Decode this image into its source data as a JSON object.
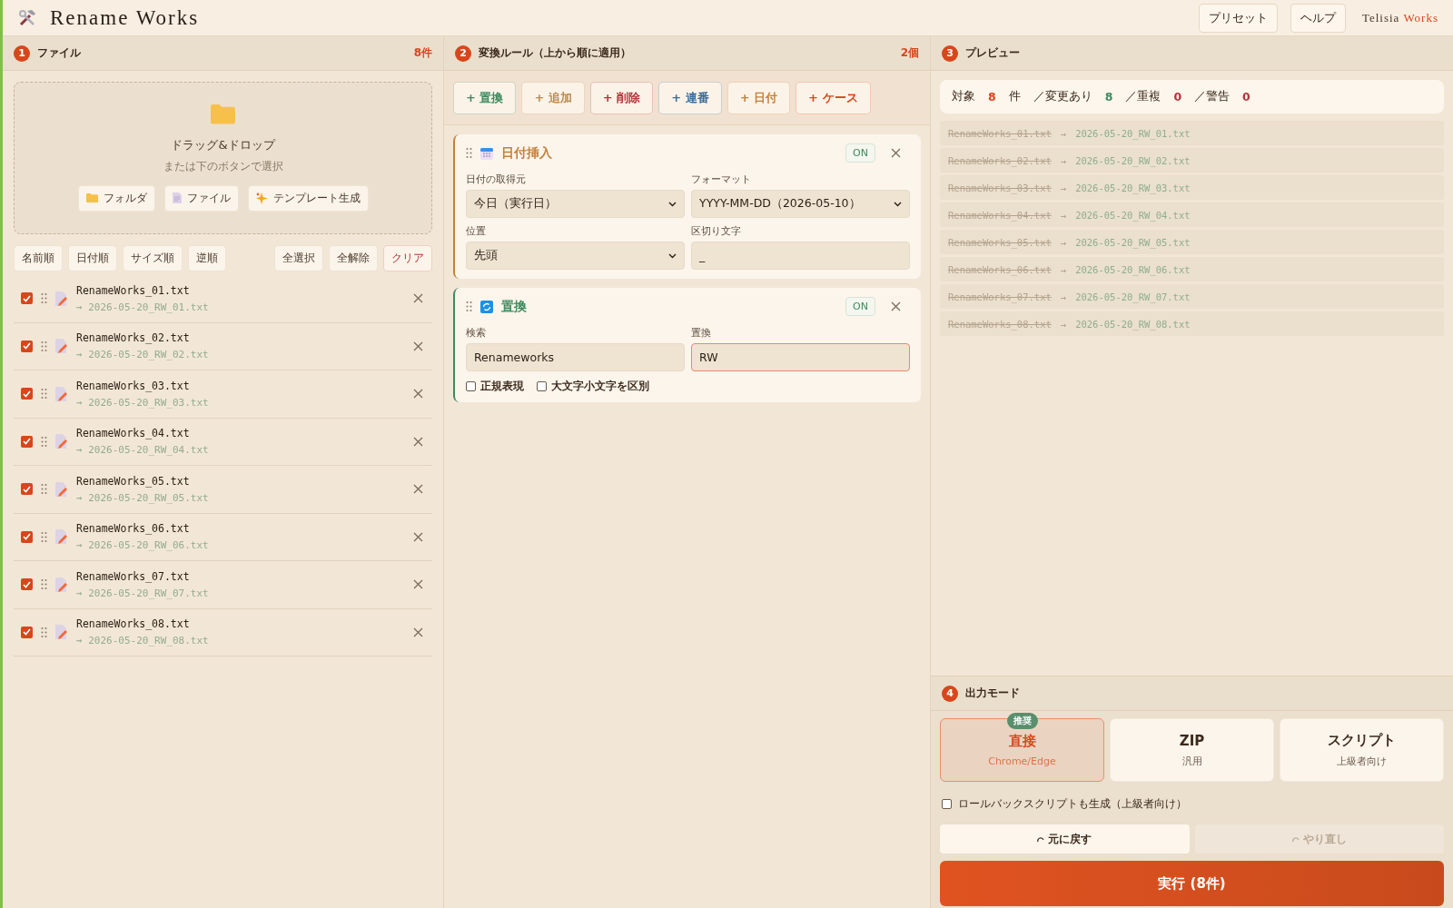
{
  "header": {
    "title": "Rename Works",
    "buttons": [
      "プリセット",
      "ヘルプ"
    ],
    "brand": {
      "name": "Telisia",
      "accent": "Works"
    }
  },
  "files_panel": {
    "number": "1",
    "title": "ファイル",
    "count": "8件",
    "dropzone": {
      "title": "ドラッグ&ドロップ",
      "subtitle": "または下のボタンで選択",
      "buttons": [
        {
          "kind": "folder",
          "label": "フォルダ"
        },
        {
          "kind": "file",
          "label": "ファイル"
        },
        {
          "kind": "sparkle",
          "label": "テンプレート生成"
        }
      ]
    },
    "sort_buttons": [
      "名前順",
      "日付順",
      "サイズ順",
      "逆順"
    ],
    "select_buttons": [
      {
        "label": "全選択",
        "kind": "normal"
      },
      {
        "label": "全解除",
        "kind": "normal"
      },
      {
        "label": "クリア",
        "kind": "danger"
      }
    ],
    "files": [
      {
        "name": "RenameWorks_01.txt",
        "new_name": "→ 2026-05-20_RW_01.txt",
        "checked": true
      },
      {
        "name": "RenameWorks_02.txt",
        "new_name": "→ 2026-05-20_RW_02.txt",
        "checked": true
      },
      {
        "name": "RenameWorks_03.txt",
        "new_name": "→ 2026-05-20_RW_03.txt",
        "checked": true
      },
      {
        "name": "RenameWorks_04.txt",
        "new_name": "→ 2026-05-20_RW_04.txt",
        "checked": true
      },
      {
        "name": "RenameWorks_05.txt",
        "new_name": "→ 2026-05-20_RW_05.txt",
        "checked": true
      },
      {
        "name": "RenameWorks_06.txt",
        "new_name": "→ 2026-05-20_RW_06.txt",
        "checked": true
      },
      {
        "name": "RenameWorks_07.txt",
        "new_name": "→ 2026-05-20_RW_07.txt",
        "checked": true
      },
      {
        "name": "RenameWorks_08.txt",
        "new_name": "→ 2026-05-20_RW_08.txt",
        "checked": true
      }
    ]
  },
  "rules_panel": {
    "number": "2",
    "title": "変換ルール（上から順に適用）",
    "count": "2個",
    "add_buttons": [
      {
        "label": "+ 置換",
        "color": "#3f8a5e"
      },
      {
        "label": "+ 追加",
        "color": "#b98a4e"
      },
      {
        "label": "+ 削除",
        "color": "#b8323a"
      },
      {
        "label": "+ 連番",
        "color": "#3d6c9a"
      },
      {
        "label": "+ 日付",
        "color": "#c2813a"
      },
      {
        "label": "+ ケース",
        "color": "#d8461c"
      }
    ],
    "rules": [
      {
        "kind": "date",
        "title": "日付挿入",
        "toggle": "ON",
        "on": true,
        "fields": [
          {
            "kind": "select",
            "label": "日付の取得元",
            "value": "今日（実行日）"
          },
          {
            "kind": "select",
            "label": "フォーマット",
            "value": "YYYY-MM-DD（2026-05-10）"
          },
          {
            "kind": "select",
            "label": "位置",
            "value": "先頭"
          },
          {
            "kind": "input",
            "label": "区切り文字",
            "value": "_"
          }
        ]
      },
      {
        "kind": "replace",
        "title": "置換",
        "toggle": "ON",
        "on": true,
        "fields": [
          {
            "kind": "input",
            "label": "検索",
            "value": "Renameworks"
          },
          {
            "kind": "input",
            "label": "置換",
            "value": "RW",
            "focused": true
          }
        ],
        "options": [
          {
            "label": "正規表現",
            "checked": false
          },
          {
            "label": "大文字小文字を区別",
            "checked": false
          }
        ]
      }
    ]
  },
  "preview_panel": {
    "number": "3",
    "title": "プレビュー",
    "summary": [
      {
        "label": "対象",
        "value": "8",
        "unit": "件",
        "color": "#d8461c"
      },
      {
        "label": "／変更あり",
        "value": "8",
        "color": "#3f8a5e"
      },
      {
        "label": "／重複",
        "value": "0",
        "color": "#b8323a"
      },
      {
        "label": "／警告",
        "value": "0",
        "color": "#b8323a"
      }
    ],
    "rows": [
      {
        "old": "RenameWorks_01.txt",
        "arrow": "→",
        "new": "2026-05-20_RW_01.txt"
      },
      {
        "old": "RenameWorks_02.txt",
        "arrow": "→",
        "new": "2026-05-20_RW_02.txt"
      },
      {
        "old": "RenameWorks_03.txt",
        "arrow": "→",
        "new": "2026-05-20_RW_03.txt"
      },
      {
        "old": "RenameWorks_04.txt",
        "arrow": "→",
        "new": "2026-05-20_RW_04.txt"
      },
      {
        "old": "RenameWorks_05.txt",
        "arrow": "→",
        "new": "2026-05-20_RW_05.txt"
      },
      {
        "old": "RenameWorks_06.txt",
        "arrow": "→",
        "new": "2026-05-20_RW_06.txt"
      },
      {
        "old": "RenameWorks_07.txt",
        "arrow": "→",
        "new": "2026-05-20_RW_07.txt"
      },
      {
        "old": "RenameWorks_08.txt",
        "arrow": "→",
        "new": "2026-05-20_RW_08.txt"
      }
    ]
  },
  "output_panel": {
    "number": "4",
    "title": "出力モード",
    "modes": [
      {
        "title": "直接",
        "subtitle": "Chrome/Edge",
        "badge": "推奨",
        "selected": true
      },
      {
        "title": "ZIP",
        "subtitle": "汎用",
        "selected": false
      },
      {
        "title": "スクリプト",
        "subtitle": "上級者向け",
        "selected": false
      }
    ],
    "rollback": {
      "label": "ロールバックスクリプトも生成（上級者向け）",
      "checked": false
    },
    "history": [
      {
        "label": "元に戻す",
        "disabled": false
      },
      {
        "label": "やり直し",
        "disabled": true
      }
    ],
    "run_button": "実行 (8件)"
  }
}
